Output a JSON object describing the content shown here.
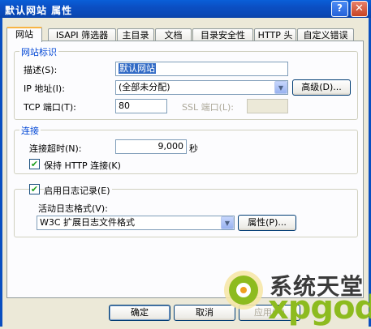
{
  "window": {
    "title": "默认网站 属性",
    "help_label": "?",
    "close_label": "✕"
  },
  "tabs": [
    {
      "label": "网站",
      "active": true
    },
    {
      "label": "ISAPI 筛选器"
    },
    {
      "label": "主目录"
    },
    {
      "label": "文档"
    },
    {
      "label": "目录安全性"
    },
    {
      "label": "HTTP 头"
    },
    {
      "label": "自定义错误"
    }
  ],
  "site_identity": {
    "group_title": "网站标识",
    "description_label": "描述(S):",
    "description_value": "默认网站",
    "ip_label": "IP 地址(I):",
    "ip_value": "(全部未分配)",
    "advanced_button": "高级(D)...",
    "tcp_label": "TCP 端口(T):",
    "tcp_value": "80",
    "ssl_label": "SSL 端口(L):",
    "ssl_value": ""
  },
  "connections": {
    "group_title": "连接",
    "timeout_label": "连接超时(N):",
    "timeout_value": "9,000",
    "timeout_unit": "秒",
    "keepalive_label": "保持 HTTP 连接(K)",
    "keepalive_checked": true
  },
  "logging": {
    "enable_label": "启用日志记录(E)",
    "enable_checked": true,
    "format_label": "活动日志格式(V):",
    "format_value": "W3C 扩展日志文件格式",
    "properties_button": "属性(P)..."
  },
  "footer": {
    "ok": "确定",
    "cancel": "取消",
    "apply": "应用(A)"
  },
  "watermark": {
    "text_cn": "系统天堂",
    "text_en": "xpgod"
  }
}
